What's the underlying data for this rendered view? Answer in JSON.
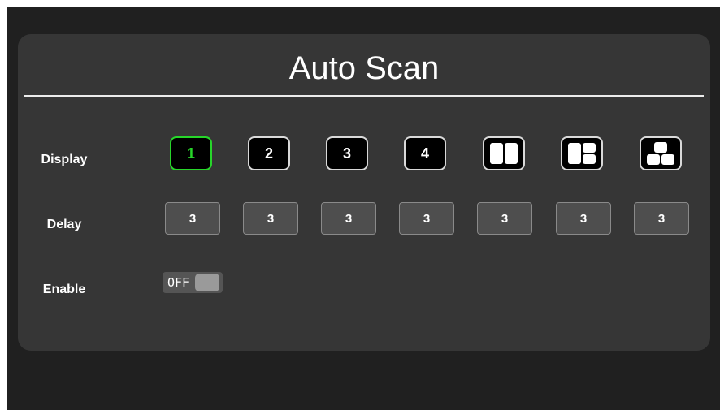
{
  "title": "Auto Scan",
  "rows": {
    "display_label": "Display",
    "delay_label": "Delay",
    "enable_label": "Enable"
  },
  "display_buttons": [
    {
      "label": "1",
      "selected": true
    },
    {
      "label": "2",
      "selected": false
    },
    {
      "label": "3",
      "selected": false
    },
    {
      "label": "4",
      "selected": false
    },
    {
      "icon": "split-2-icon",
      "selected": false
    },
    {
      "icon": "split-3-icon",
      "selected": false
    },
    {
      "icon": "split-3-pyramid-icon",
      "selected": false
    }
  ],
  "delay_values": [
    "3",
    "3",
    "3",
    "3",
    "3",
    "3",
    "3"
  ],
  "enable": {
    "state_label": "OFF",
    "on": false
  },
  "colors": {
    "screen_bg": "#202020",
    "panel_bg": "#363636",
    "selected_accent": "#27d62a",
    "delay_button_bg": "#4e4e4e"
  }
}
